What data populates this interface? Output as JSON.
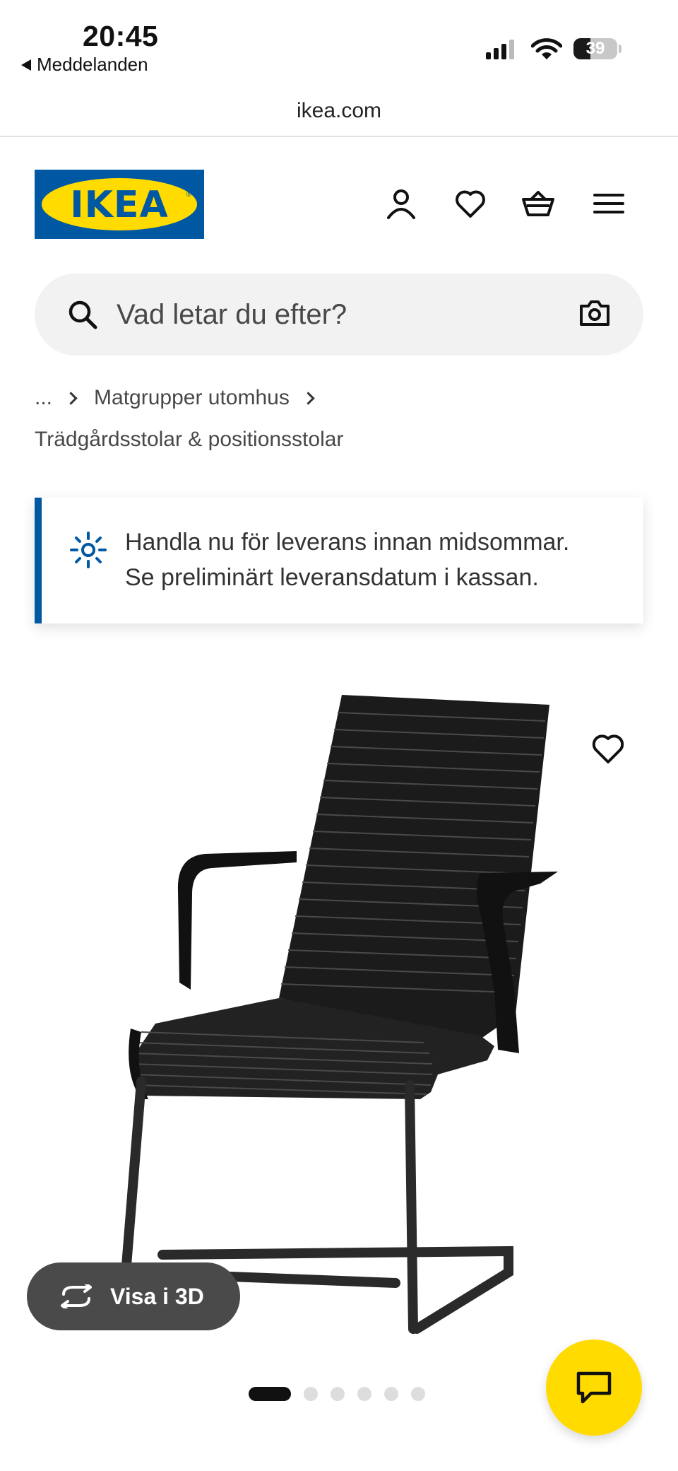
{
  "status_bar": {
    "time": "20:45",
    "back_label": "Meddelanden",
    "battery_percent": 39
  },
  "browser": {
    "url": "ikea.com"
  },
  "header": {
    "logo_text": "IKEA",
    "icons": [
      "user-icon",
      "heart-icon",
      "basket-icon",
      "menu-icon"
    ]
  },
  "search": {
    "placeholder": "Vad letar du efter?"
  },
  "breadcrumb": {
    "ellipsis": "...",
    "items": [
      "Matgrupper utomhus",
      "Trädgårdsstolar & positionsstolar"
    ]
  },
  "banner": {
    "line1": "Handla nu för leverans innan midsommar.",
    "line2": "Se preliminärt leveransdatum i kassan."
  },
  "product": {
    "view_3d_label": "Visa i 3D",
    "carousel": {
      "total_images": 6,
      "current_index": 1
    }
  },
  "colors": {
    "ikea_blue": "#0058a3",
    "ikea_yellow": "#ffdb00",
    "search_bg": "#f2f2f2",
    "view3d_bg": "#4a4a4a"
  }
}
